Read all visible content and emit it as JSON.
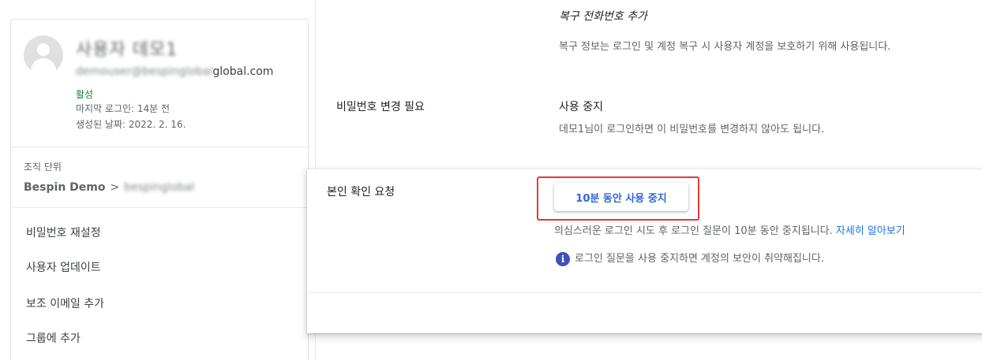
{
  "user": {
    "name": "사용자 데모1",
    "email_masked": "demouser@bespinglobal",
    "email_suffix": "global.com",
    "status": "활성",
    "last_login": "마지막 로그인: 14분 전",
    "created": "생성된 날짜: 2022. 2. 16."
  },
  "org_unit": {
    "label": "조직 단위",
    "root": "Bespin Demo",
    "separator": ">",
    "child_masked": "bespinglobal"
  },
  "actions": [
    {
      "label": "비밀번호 재설정"
    },
    {
      "label": "사용자 업데이트"
    },
    {
      "label": "보조 이메일 추가"
    },
    {
      "label": "그룹에 추가"
    }
  ],
  "recovery": {
    "title": "복구 전화번호 추가",
    "description": "복구 정보는 로그인 및 계정 복구 시 사용자 계정을 보호하기 위해 사용됩니다."
  },
  "password_change": {
    "label": "비밀번호 변경 필요",
    "value": "사용 중지",
    "description": "데모1님이 로그인하면 이 비밀번호를 변경하지 않아도 됩니다."
  },
  "identity_verification": {
    "label": "본인 확인 요청",
    "button_label": "10분 동안 사용 중지",
    "description": "의심스러운 로그인 시도 후 로그인 질문이 10분 동안 중지됩니다.",
    "learn_more": "자세히 알아보기",
    "info_icon": "i",
    "warning": "로그인 질문을 사용 중지하면 계정의 보안이 취약해집니다."
  },
  "colors": {
    "accent_blue": "#3367d6",
    "link_blue": "#1a73e8",
    "active_green": "#188038",
    "highlight_red": "#e53935",
    "info_icon": "#3f51b5"
  }
}
